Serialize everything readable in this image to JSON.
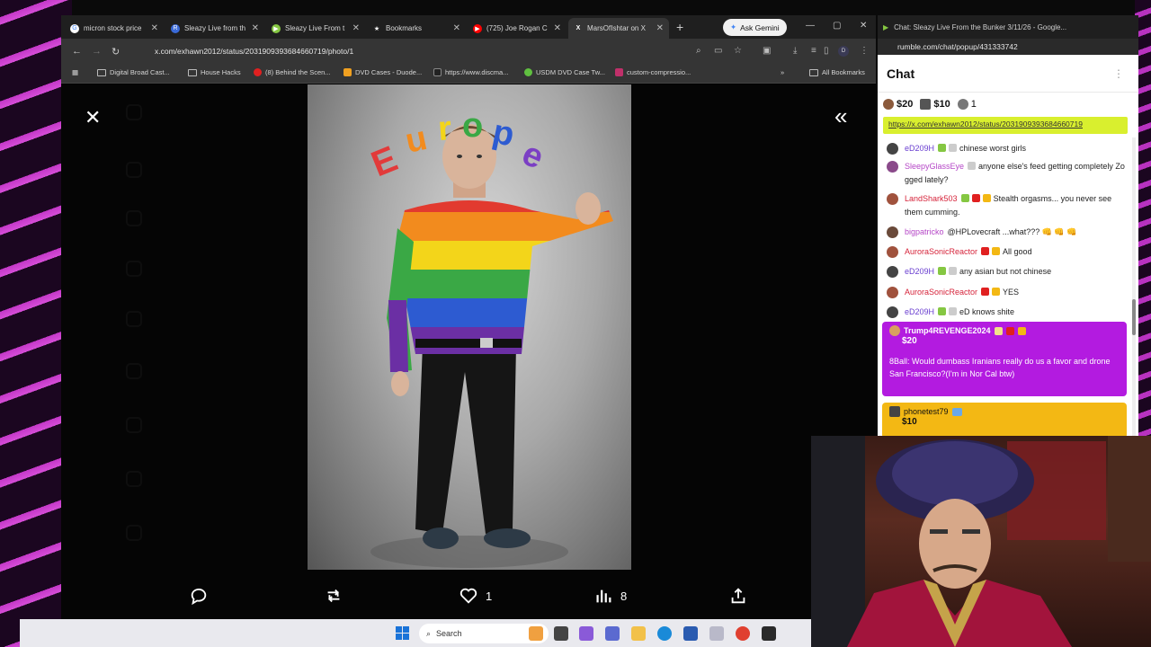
{
  "browser": {
    "tabs": [
      {
        "title": "micron stock price",
        "fav_color": "#ffffff",
        "fav_glyph": "G"
      },
      {
        "title": "Sleazy Live from th",
        "fav_color": "#3a6ad8",
        "fav_glyph": "R"
      },
      {
        "title": "Sleazy Live From t",
        "fav_color": "#85c742",
        "fav_glyph": "▶"
      },
      {
        "title": "Bookmarks",
        "fav_color": "#ffffff",
        "fav_glyph": "★"
      },
      {
        "title": "(725) Joe Rogan C",
        "fav_color": "#ff0000",
        "fav_glyph": "▶"
      },
      {
        "title": "MarsOfIshtar on X",
        "fav_color": "#000000",
        "fav_glyph": "X"
      }
    ],
    "active_tab": 5,
    "ask_gemini_label": "Ask Gemini",
    "url": "x.com/exhawn2012/status/2031909393684660719/photo/1",
    "bookmarks": [
      {
        "label": "Digital Broad Cast...",
        "kind": "folder"
      },
      {
        "label": "House Hacks",
        "kind": "folder"
      },
      {
        "label": "(8) Behind the Scen...",
        "kind": "site",
        "color": "#e02020"
      },
      {
        "label": "DVD Cases - Duode...",
        "kind": "site",
        "color": "#f0a020"
      },
      {
        "label": "https://www.discma...",
        "kind": "site",
        "color": "#222222"
      },
      {
        "label": "USDM DVD Case Tw...",
        "kind": "site",
        "color": "#60c040"
      },
      {
        "label": "custom-compressio...",
        "kind": "site",
        "color": "#c0306a"
      }
    ],
    "all_bookmarks_label": "All Bookmarks"
  },
  "photo_viewer": {
    "overlay_text": "Europe",
    "actions": {
      "reply": {
        "icon": "reply-icon",
        "count": ""
      },
      "repost": {
        "icon": "repost-icon",
        "count": ""
      },
      "like": {
        "icon": "heart-icon",
        "count": "1"
      },
      "views": {
        "icon": "views-icon",
        "count": "8"
      },
      "share": {
        "icon": "share-icon",
        "count": ""
      }
    }
  },
  "taskbar": {
    "search_placeholder": "Search"
  },
  "chat": {
    "window_title": "Chat: Sleazy Live From the Bunker 3/11/26 - Google...",
    "url": "rumble.com/chat/popup/431333742",
    "title": "Chat",
    "tip_summary": [
      {
        "amount": "$20",
        "color": "#8b5a3c"
      },
      {
        "amount": "$10",
        "color": "#555555"
      },
      {
        "amount": "1",
        "color": "#777777"
      }
    ],
    "pinned_link": "https://x.com/exhawn2012/status/2031909393684660719",
    "messages": [
      {
        "user": "eD209H",
        "text": "chinese worst girls",
        "color": "#6a3fd0"
      },
      {
        "user": "SleepyGlassEye",
        "text": "anyone else's feed getting completely Zo gged lately?",
        "color": "#b547c7"
      },
      {
        "user": "LandShark503",
        "text": "Stealth orgasms... you never see them cumming.",
        "color": "#d6243b"
      },
      {
        "user": "bigpatricko",
        "text": "@HPLovecraft ...what??? 👊 👊 👊",
        "color": "#b547c7"
      },
      {
        "user": "AuroraSonicReactor",
        "text": "All good",
        "color": "#d6243b"
      },
      {
        "user": "eD209H",
        "text": "any asian but not chinese",
        "color": "#6a3fd0"
      },
      {
        "user": "AuroraSonicReactor",
        "text": "YES",
        "color": "#d6243b"
      },
      {
        "user": "eD209H",
        "text": "eD knows shite",
        "color": "#6a3fd0"
      }
    ],
    "rants": [
      {
        "user": "Trump4REVENGE2024",
        "amount": "$20",
        "text": "8Ball: Would dumbass Iranians really do us a favor and drone San Francisco?(I'm in Nor Cal btw)",
        "color": "#b31be0"
      },
      {
        "user": "phonetest79",
        "amount": "$10",
        "text": "",
        "color": "#f3b814"
      }
    ]
  }
}
